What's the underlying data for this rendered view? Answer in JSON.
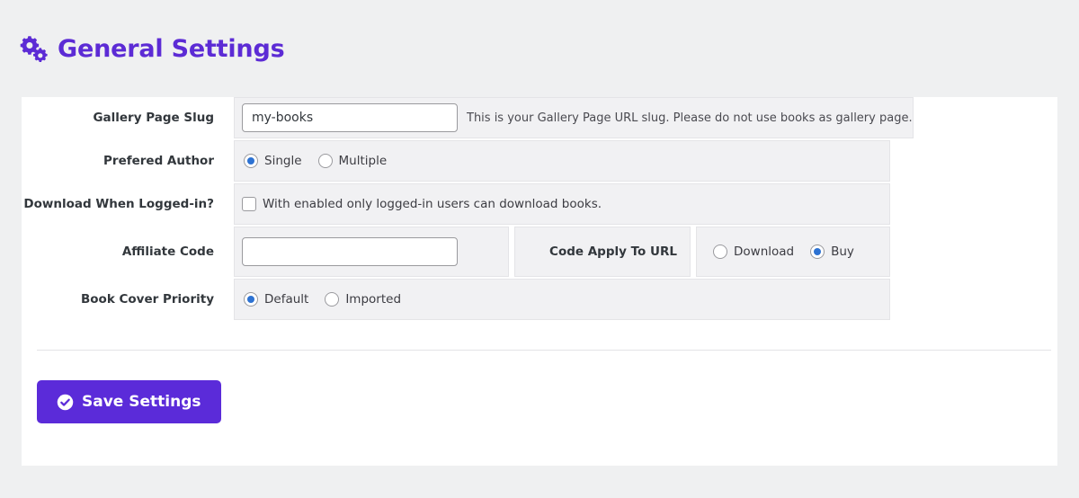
{
  "header": {
    "title": "General Settings",
    "icon": "gears-icon"
  },
  "form": {
    "rows": [
      {
        "label": "Gallery Page Slug",
        "type": "text",
        "value": "my-books",
        "placeholder": "",
        "help": "This is your Gallery Page URL slug. Please do not use books as gallery page."
      },
      {
        "label": "Prefered Author",
        "type": "radio",
        "options": [
          {
            "label": "Single",
            "selected": true
          },
          {
            "label": "Multiple",
            "selected": false
          }
        ]
      },
      {
        "label": "Download When Logged-in?",
        "type": "checkbox",
        "checked": false,
        "text": "With enabled only logged-in users can download books."
      },
      {
        "label": "Affiliate Code",
        "type": "split",
        "value": "",
        "placeholder": "",
        "sub_label": "Code Apply To URL",
        "options": [
          {
            "label": "Download",
            "selected": false
          },
          {
            "label": "Buy",
            "selected": true
          }
        ]
      },
      {
        "label": "Book Cover Priority",
        "type": "radio",
        "options": [
          {
            "label": "Default",
            "selected": true
          },
          {
            "label": "Imported",
            "selected": false
          }
        ]
      }
    ]
  },
  "footer": {
    "save_label": "Save Settings",
    "save_icon": "check-circle-icon"
  },
  "colors": {
    "brand_purple": "#5c2bd5",
    "button_purple": "#5b2bd9",
    "radio_blue": "#2d72d2",
    "page_background": "#eff0f1",
    "card_background": "#ffffff",
    "field_background": "#f1f1f3"
  }
}
